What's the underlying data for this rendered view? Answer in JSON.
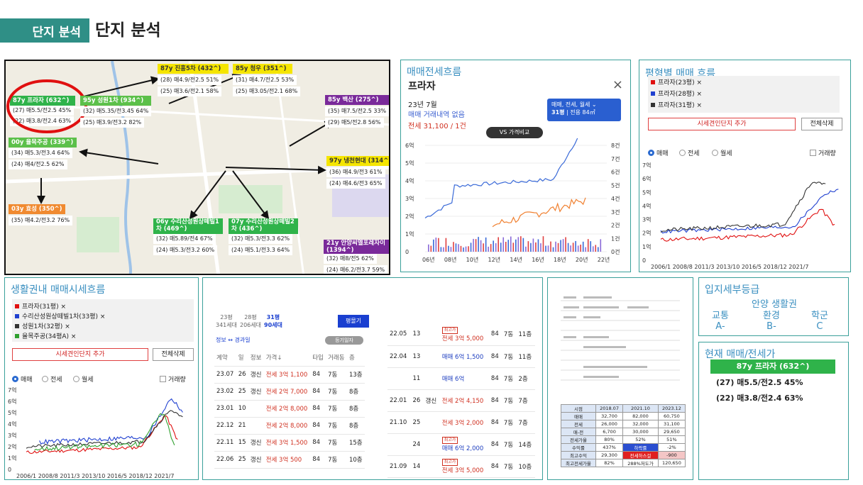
{
  "header": {
    "tag": "단지 분석",
    "title": "단지 분석"
  },
  "map": {
    "main": {
      "name": "87y 프라자 (632^)",
      "r1": "(27) 매5.5/전2.5 45%",
      "r2": "(22) 매3.8/전2.4 63%"
    },
    "c1": {
      "name": "87y 진흥5차 (432^)",
      "r1": "(28) 매4.9/전2.5 51%",
      "r2": "(25) 매3.6/전2.1 58%"
    },
    "c2": {
      "name": "85y 청우 (351^)",
      "r1": "(31) 매4.7/전2.5 53%",
      "r2": "(25) 매3.05/전2.1 68%"
    },
    "c3": {
      "name": "95y 성원1차 (934^)",
      "r1": "(32) 매5.35/전3.45 64%",
      "r2": "(25) 매3.9/전3.2 82%"
    },
    "c4": {
      "name": "85y 백산 (275^)",
      "r1": "(35) 매7.5/전2.5 33%",
      "r2": "(29) 매5/전2.8 56%"
    },
    "c5": {
      "name": "00y 율목주공 (339^)",
      "r1": "(34) 매5.3/전3.4 64%",
      "r2": "(24) 매4/전2.5 62%"
    },
    "c6": {
      "name": "97y 냉천현대 (314^)",
      "r1": "(36) 매4.9/전3 61%",
      "r2": "(24) 매4.6/전3 65%"
    },
    "c7": {
      "name": "03y 효성 (350^)",
      "r1": "(35) 매4.2/전3.2 76%"
    },
    "c8": {
      "name": "06y 수리산성원상떼빌1차 (469^)",
      "r1": "(32) 매5.89/전4 67%",
      "r2": "(24) 매5.3/전3.2 60%"
    },
    "c9": {
      "name": "07y 수리산성원상떼빌2차 (436^)",
      "r1": "(32) 매5.3/전3.3 62%",
      "r2": "(24) 매5.1/전3.3 64%"
    },
    "c10": {
      "name": "21y 안양씨엘포레자이 (1394^)",
      "r1": "(32) 매8/전5 62%",
      "r2": "(24) 매6.2/전3.7 59%"
    }
  },
  "flow": {
    "title": "매매전세흐름",
    "name": "프라자",
    "date": "23년 7월",
    "none": "매매 거래내역 없음",
    "jeonse": "전세 31,100 / 1건",
    "vs": "VS 가격비교",
    "dropdown": "매매, 전세, 월세",
    "size": "31평",
    "size_sub": "전용 84㎡",
    "close": "×",
    "yl": [
      "6억",
      "5억",
      "4억",
      "3억",
      "2억",
      "1억",
      "0"
    ],
    "yr": [
      "8건",
      "7건",
      "6건",
      "5건",
      "4건",
      "3건",
      "2건",
      "1건",
      "0건"
    ],
    "xl": [
      "06년",
      "08년",
      "10년",
      "12년",
      "14년",
      "16년",
      "18년",
      "20년",
      "22년"
    ]
  },
  "size_flow": {
    "title": "평형별 매매 흐름",
    "items": [
      "프라자(23평)",
      "프라자(28평)",
      "프라자(31평)"
    ],
    "add": "시세견인단지 추가",
    "clear": "전체삭제",
    "r1": "매매",
    "r2": "전세",
    "r3": "월세",
    "vol": "거래량",
    "yl": [
      "7억",
      "6억",
      "5억",
      "4억",
      "3억",
      "2억",
      "1억",
      "0"
    ],
    "xl": "2006/1  2008/8  2011/3 2013/10 2016/5 2018/12  2021/7"
  },
  "area_flow": {
    "title": "생활권내 매매시세흐름",
    "items": [
      "프라자(31평)",
      "수리산성원상떼빌1차(33평)",
      "성원1차(32평)",
      "율목주공(34평A)"
    ],
    "add": "시세견인단지 추가",
    "clear": "전체삭제",
    "r1": "매매",
    "r2": "전세",
    "r3": "월세",
    "vol": "거래량",
    "yl": [
      "7억",
      "6억",
      "5억",
      "4억",
      "3억",
      "2억",
      "1억",
      "0"
    ],
    "xl": "2006/1  2008/8  2011/3 2013/10 2016/5 2018/12  2021/7"
  },
  "trades": {
    "sizes": [
      {
        "p": "23평",
        "h": "341세대"
      },
      {
        "p": "28평",
        "h": "206세대"
      },
      {
        "p": "31평",
        "h": "90세대"
      }
    ],
    "btn": "평몰기",
    "info": "정보 ↔ 경과일",
    "reg": "등기일자",
    "head": [
      "계약",
      "일",
      "정보",
      "가격↓",
      "타입",
      "거래동",
      "층"
    ],
    "rows": [
      [
        "23.07",
        "26",
        "갱신",
        "전세 3억 1,100",
        "84",
        "7동",
        "13층"
      ],
      [
        "23.02",
        "25",
        "갱신",
        "전세 2억 7,000",
        "84",
        "7동",
        "8층"
      ],
      [
        "23.01",
        "10",
        "",
        "전세 2억 8,000",
        "84",
        "7동",
        "8층"
      ],
      [
        "22.12",
        "21",
        "",
        "전세 2억 8,000",
        "84",
        "7동",
        "8층"
      ],
      [
        "22.11",
        "15",
        "갱신",
        "전세 3억 1,500",
        "84",
        "7동",
        "15층"
      ],
      [
        "22.06",
        "25",
        "갱신",
        "전세 3억 500",
        "84",
        "7동",
        "10층"
      ]
    ]
  },
  "trades2": {
    "rows": [
      [
        "22.05",
        "13",
        "",
        "최고가",
        "전세 3억 5,000",
        "84",
        "7동",
        "11층"
      ],
      [
        "22.04",
        "13",
        "",
        "",
        "매매 6억 1,500",
        "84",
        "7동",
        "11층"
      ],
      [
        "",
        "11",
        "",
        "",
        "매매 6억",
        "84",
        "7동",
        "2층"
      ],
      [
        "22.01",
        "26",
        "갱신",
        "",
        "전세 2억 4,150",
        "84",
        "7동",
        "7층"
      ],
      [
        "21.10",
        "25",
        "",
        "",
        "전세 3억 2,000",
        "84",
        "7동",
        "7층"
      ],
      [
        "",
        "24",
        "",
        "최고가",
        "매매 6억 2,000",
        "84",
        "7동",
        "14층"
      ],
      [
        "21.09",
        "14",
        "",
        "최고가",
        "전세 3억 5,000",
        "84",
        "7동",
        "10층"
      ]
    ]
  },
  "summary": {
    "head": [
      "시점",
      "2018.07",
      "2021.10",
      "2023.12"
    ],
    "rows": [
      [
        "매매",
        "32,700",
        "82,000",
        "60,750"
      ],
      [
        "전세",
        "26,000",
        "32,000",
        "31,100"
      ],
      [
        "매-전",
        "6,700",
        "30,000",
        "29,650"
      ],
      [
        "전세가율",
        "80%",
        "52%",
        "51%"
      ],
      [
        "수익률",
        "437%",
        "하락률",
        "-2%"
      ],
      [
        "최고수익",
        "29,300",
        "전세하스걸",
        "-900"
      ],
      [
        "최고전세가율",
        "82%",
        "288%저도가",
        "120,650"
      ]
    ]
  },
  "grade": {
    "title": "입지세부등급",
    "center": "안양 생활권",
    "cols": [
      {
        "k": "교통",
        "v": "A-"
      },
      {
        "k": "환경",
        "v": "B-"
      },
      {
        "k": "학군",
        "v": "C"
      }
    ]
  },
  "current": {
    "title": "현재 매매/전세가",
    "name": "87y 프라자 (632^)",
    "r1": "(27) 매5.5/전2.5 45%",
    "r2": "(22) 매3.8/전2.4 63%"
  },
  "colors": {
    "teal": "#2f8f86",
    "green": "#2fb34a",
    "yellow": "#f5e500",
    "purple": "#7a2a9a",
    "orange": "#f08a30"
  }
}
